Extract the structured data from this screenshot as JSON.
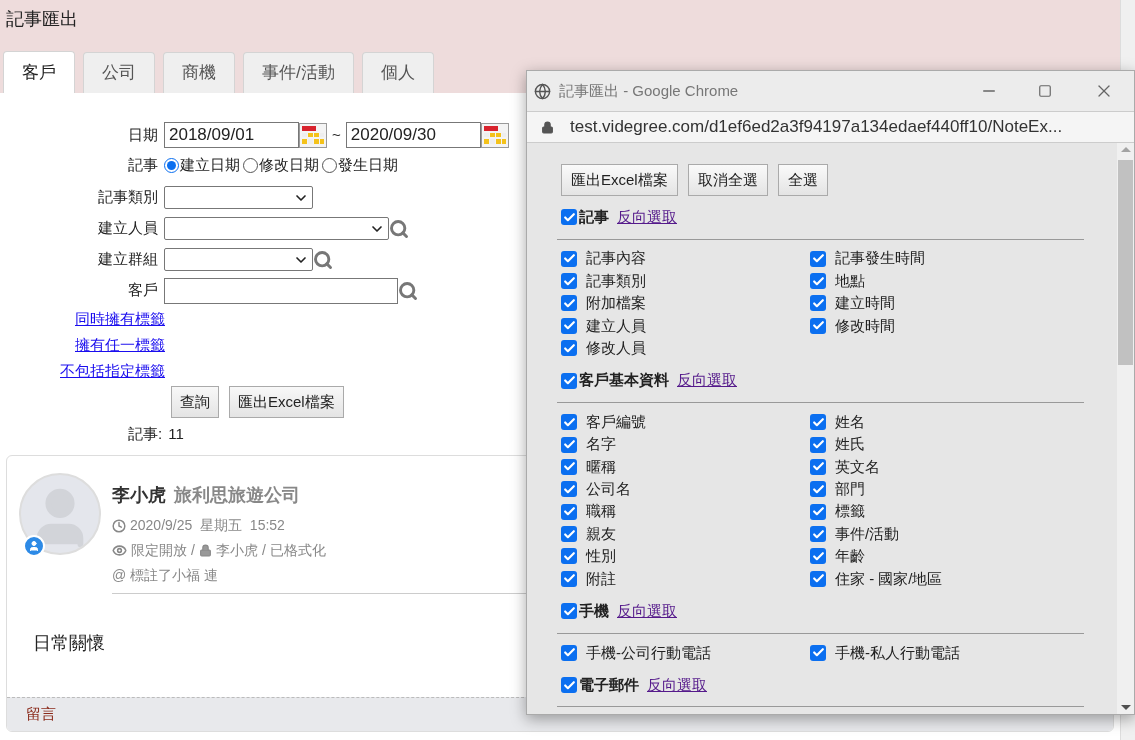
{
  "page": {
    "title": "記事匯出"
  },
  "tabs": [
    {
      "label": "客戶",
      "selected": true
    },
    {
      "label": "公司",
      "selected": false
    },
    {
      "label": "商機",
      "selected": false
    },
    {
      "label": "事件/活動",
      "selected": false
    },
    {
      "label": "個人",
      "selected": false
    }
  ],
  "form": {
    "date": {
      "label": "日期",
      "from": "2018/09/01",
      "separator": "~",
      "to": "2020/09/30"
    },
    "date_type": {
      "label": "記事",
      "options": [
        {
          "label": "建立日期",
          "selected": true
        },
        {
          "label": "修改日期",
          "selected": false
        },
        {
          "label": "發生日期",
          "selected": false
        }
      ]
    },
    "fields": [
      {
        "kind": "select",
        "label": "記事類別",
        "search": false
      },
      {
        "kind": "long_select",
        "label": "建立人員",
        "search": true
      },
      {
        "kind": "select",
        "label": "建立群組",
        "search": true
      },
      {
        "kind": "text",
        "label": "客戶",
        "search": true
      }
    ],
    "tag_links": [
      "同時擁有標籤",
      "擁有任一標籤",
      "不包括指定標籤"
    ],
    "buttons": [
      "查詢",
      "匯出Excel檔案"
    ],
    "count": {
      "label": "記事:",
      "value": "11"
    }
  },
  "note": {
    "author": "李小虎",
    "company": "旅利思旅遊公司",
    "time": "2020/9/25  星期五  15:52",
    "access": {
      "visibility": "限定開放",
      "sep_1": "/",
      "owner": "李小虎",
      "sep_2": "/",
      "format": "已格式化"
    },
    "mention_prefix": "@",
    "mention": "標註了小福 連",
    "body": "日常關懷",
    "comment": "留言"
  },
  "popup": {
    "title": "記事匯出 - Google Chrome",
    "url": "test.videgree.com/d1ef6ed2a3f94197a134edaef440ff10/NoteEx...",
    "buttons": [
      "匯出Excel檔案",
      "取消全選",
      "全選"
    ],
    "sections": [
      {
        "label": "記事",
        "checked": true,
        "invert": "反向選取",
        "items": [
          {
            "label": "記事內容",
            "checked": true
          },
          {
            "label": "記事發生時間",
            "checked": true
          },
          {
            "label": "記事類別",
            "checked": true
          },
          {
            "label": "地點",
            "checked": true
          },
          {
            "label": "附加檔案",
            "checked": true
          },
          {
            "label": "建立時間",
            "checked": true
          },
          {
            "label": "建立人員",
            "checked": true
          },
          {
            "label": "修改時間",
            "checked": true
          },
          {
            "label": "修改人員",
            "checked": true
          }
        ]
      },
      {
        "label": "客戶基本資料",
        "checked": true,
        "invert": "反向選取",
        "items": [
          {
            "label": "客戶編號",
            "checked": true
          },
          {
            "label": "姓名",
            "checked": true
          },
          {
            "label": "名字",
            "checked": true
          },
          {
            "label": "姓氏",
            "checked": true
          },
          {
            "label": "暱稱",
            "checked": true
          },
          {
            "label": "英文名",
            "checked": true
          },
          {
            "label": "公司名",
            "checked": true
          },
          {
            "label": "部門",
            "checked": true
          },
          {
            "label": "職稱",
            "checked": true
          },
          {
            "label": "標籤",
            "checked": true
          },
          {
            "label": "親友",
            "checked": true
          },
          {
            "label": "事件/活動",
            "checked": true
          },
          {
            "label": "性別",
            "checked": true
          },
          {
            "label": "年齡",
            "checked": true
          },
          {
            "label": "附註",
            "checked": true
          },
          {
            "label": "住家 - 國家/地區",
            "checked": true
          }
        ]
      },
      {
        "label": "手機",
        "checked": true,
        "invert": "反向選取",
        "items": [
          {
            "label": "手機-公司行動電話",
            "checked": true
          },
          {
            "label": "手機-私人行動電話",
            "checked": true
          }
        ]
      },
      {
        "label": "電子郵件",
        "checked": true,
        "invert": "反向選取"
      }
    ]
  }
}
